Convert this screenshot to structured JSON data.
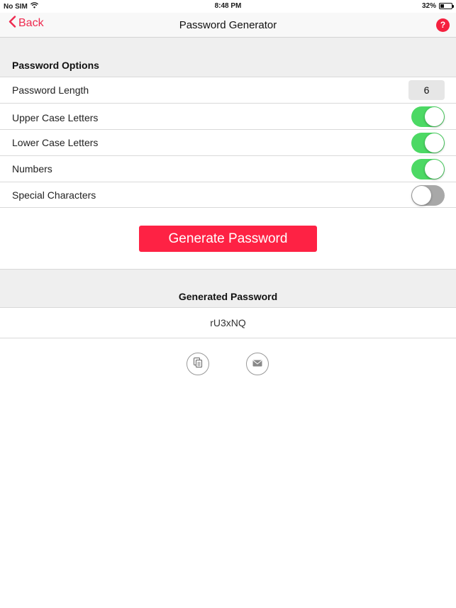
{
  "status_bar": {
    "carrier": "No SIM",
    "time": "8:48 PM",
    "battery": "32%",
    "battery_level": 0.32
  },
  "nav": {
    "back_label": "Back",
    "title": "Password Generator",
    "help_label": "?"
  },
  "options": {
    "header": "Password Options",
    "length": {
      "label": "Password Length",
      "value": "6"
    },
    "toggles": [
      {
        "label": "Upper Case Letters",
        "on": true
      },
      {
        "label": "Lower Case Letters",
        "on": true
      },
      {
        "label": "Numbers",
        "on": true
      },
      {
        "label": "Special Characters",
        "on": false
      }
    ]
  },
  "generate_button_label": "Generate Password",
  "result": {
    "header": "Generated Password",
    "password": "rU3xNQ"
  },
  "actions": {
    "copy_icon": "copy-icon",
    "mail_icon": "mail-icon"
  },
  "colors": {
    "accent": "#fe2244",
    "toggle_on": "#4cd964",
    "toggle_off": "#a8a8a8"
  }
}
